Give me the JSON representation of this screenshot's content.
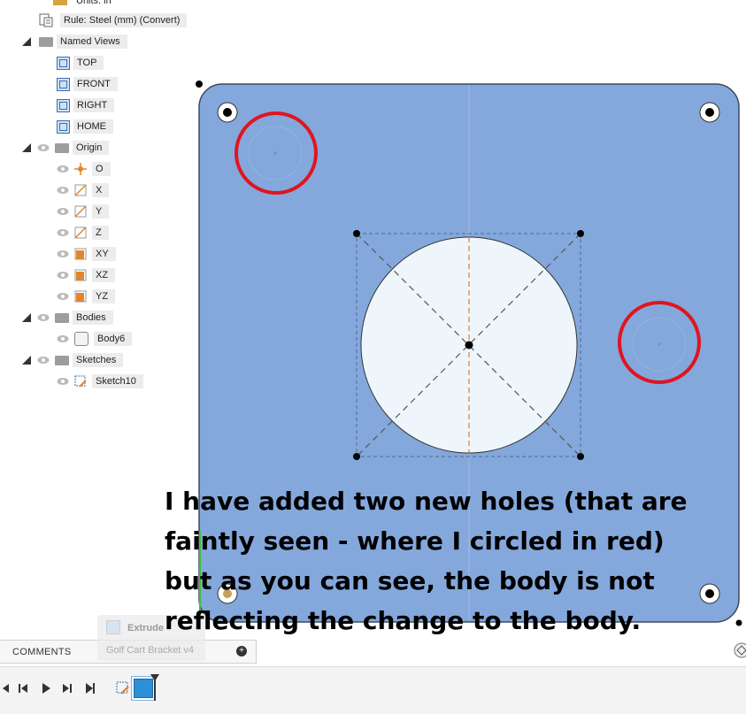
{
  "browser_tree": {
    "units_label": "Units: in",
    "rule_label": "Rule: Steel (mm) (Convert)",
    "named_views_label": "Named Views",
    "views": [
      "TOP",
      "FRONT",
      "RIGHT",
      "HOME"
    ],
    "origin_label": "Origin",
    "origin_items": [
      {
        "label": "O",
        "icon": "origin-point-icon"
      },
      {
        "label": "X",
        "icon": "axis-icon"
      },
      {
        "label": "Y",
        "icon": "axis-icon"
      },
      {
        "label": "Z",
        "icon": "axis-icon"
      },
      {
        "label": "XY",
        "icon": "plane-icon"
      },
      {
        "label": "XZ",
        "icon": "plane-icon"
      },
      {
        "label": "YZ",
        "icon": "plane-icon"
      }
    ],
    "bodies_label": "Bodies",
    "body_item": "Body6",
    "sketches_label": "Sketches",
    "sketch_item": "Sketch10"
  },
  "colors": {
    "plate_fill": "#84a8dc",
    "plate_edge": "#3d4a5c",
    "circle_fill": "#eef6fb",
    "annotation_red": "#e0151f",
    "construction_orange": "#e07a2e"
  },
  "caption": {
    "lines": [
      "I have added two new holes (that are",
      "faintly seen - where I circled in red)",
      "but as you can see, the body is not",
      "reflecting the change to the body."
    ]
  },
  "comments": {
    "label": "COMMENTS"
  },
  "tooltip": {
    "title": "Extrude",
    "subtitle": "Golf Cart Bracket v4"
  },
  "timeline": {
    "buttons": [
      "skip-start",
      "step-back",
      "play",
      "step-forward",
      "skip-end"
    ]
  }
}
